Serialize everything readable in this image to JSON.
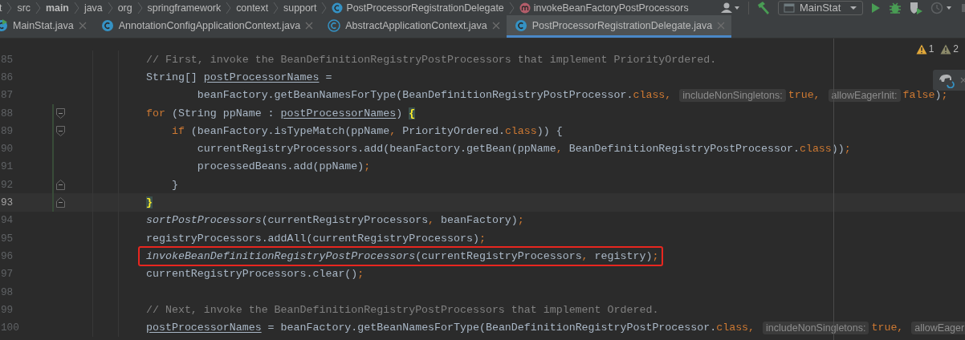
{
  "breadcrumbs": [
    {
      "label": "t",
      "kind": "folder",
      "bold": false
    },
    {
      "label": "src",
      "kind": "folder",
      "bold": false
    },
    {
      "label": "main",
      "kind": "folder",
      "bold": true
    },
    {
      "label": "java",
      "kind": "folder",
      "bold": false
    },
    {
      "label": "org",
      "kind": "folder",
      "bold": false
    },
    {
      "label": "springframework",
      "kind": "folder",
      "bold": false
    },
    {
      "label": "context",
      "kind": "folder",
      "bold": false
    },
    {
      "label": "support",
      "kind": "folder",
      "bold": false
    },
    {
      "label": "PostProcessorRegistrationDelegate",
      "kind": "class",
      "bold": false
    },
    {
      "label": "invokeBeanFactoryPostProcessors",
      "kind": "method",
      "bold": false
    }
  ],
  "toolbar": {
    "run_config": "MainStat"
  },
  "tabs": [
    {
      "label": "MainStat.java",
      "kind": "runnable",
      "selected": false
    },
    {
      "label": "AnnotationConfigApplicationContext.java",
      "kind": "class",
      "selected": false
    },
    {
      "label": "AbstractApplicationContext.java",
      "kind": "abstract",
      "selected": false
    },
    {
      "label": "PostProcessorRegistrationDelegate.java",
      "kind": "class",
      "selected": true
    }
  ],
  "inspections": [
    {
      "count": "1",
      "kind": "warning"
    },
    {
      "count": "2",
      "kind": "weak"
    }
  ],
  "code": [
    {
      "number": "85",
      "modified": false,
      "current": false,
      "highlighted": false,
      "tokens": [
        {
          "text": "// First, invoke the BeanDefinitionRegistryPostProcessors that implement PriorityOrdered.",
          "kind": "comment"
        }
      ]
    },
    {
      "number": "86",
      "modified": false,
      "current": false,
      "highlighted": false,
      "tokens": [
        {
          "text": "String[] ",
          "kind": "text"
        },
        {
          "text": "postProcessorNames",
          "kind": "var"
        },
        {
          "text": " =",
          "kind": "text"
        }
      ]
    },
    {
      "number": "87",
      "modified": false,
      "current": false,
      "highlighted": false,
      "tokens": [
        {
          "text": "        beanFactory.getBeanNamesForType(BeanDefinitionRegistryPostProcessor.",
          "kind": "text"
        },
        {
          "text": "class, ",
          "kind": "kw"
        },
        {
          "text": "includeNonSingletons:",
          "kind": "hint"
        },
        {
          "text": "true, ",
          "kind": "kw"
        },
        {
          "text": "allowEagerInit:",
          "kind": "hint"
        },
        {
          "text": "false",
          "kind": "kw"
        },
        {
          "text": ")",
          "kind": "text"
        },
        {
          "text": ";",
          "kind": "kw"
        }
      ]
    },
    {
      "number": "88",
      "modified": true,
      "kind": "opener",
      "current": false,
      "highlighted": false,
      "tokens": [
        {
          "text": "for",
          "kind": "kw"
        },
        {
          "text": " (String ppName : ",
          "kind": "text"
        },
        {
          "text": "postProcessorNames",
          "kind": "var"
        },
        {
          "text": ") ",
          "kind": "text"
        },
        {
          "text": "{",
          "kind": "brace"
        }
      ]
    },
    {
      "number": "89",
      "modified": true,
      "kind": "opener",
      "current": false,
      "highlighted": false,
      "tokens": [
        {
          "text": "    if",
          "kind": "kw"
        },
        {
          "text": " (beanFactory.isTypeMatch(ppName",
          "kind": "text"
        },
        {
          "text": ", ",
          "kind": "kw"
        },
        {
          "text": "PriorityOrdered.",
          "kind": "text"
        },
        {
          "text": "class",
          "kind": "kw"
        },
        {
          "text": ")) {",
          "kind": "text"
        }
      ]
    },
    {
      "number": "90",
      "modified": true,
      "current": false,
      "highlighted": false,
      "tokens": [
        {
          "text": "        currentRegistryProcessors.add(beanFactory.getBean(ppName",
          "kind": "text"
        },
        {
          "text": ", ",
          "kind": "kw"
        },
        {
          "text": "BeanDefinitionRegistryPostProcessor.",
          "kind": "text"
        },
        {
          "text": "class",
          "kind": "kw"
        },
        {
          "text": "))",
          "kind": "text"
        },
        {
          "text": ";",
          "kind": "kw"
        }
      ]
    },
    {
      "number": "91",
      "modified": true,
      "current": false,
      "highlighted": false,
      "tokens": [
        {
          "text": "        processedBeans.add(ppName)",
          "kind": "text"
        },
        {
          "text": ";",
          "kind": "kw"
        }
      ]
    },
    {
      "number": "92",
      "modified": true,
      "kind": "closer",
      "current": false,
      "highlighted": false,
      "tokens": [
        {
          "text": "    }",
          "kind": "text"
        }
      ]
    },
    {
      "number": "93",
      "modified": true,
      "kind": "closer",
      "current": true,
      "highlighted": false,
      "tokens": [
        {
          "text": "}",
          "kind": "brace"
        }
      ]
    },
    {
      "number": "94",
      "modified": false,
      "current": false,
      "highlighted": false,
      "tokens": [
        {
          "text": "sortPostProcessors",
          "kind": "static"
        },
        {
          "text": "(currentRegistryProcessors",
          "kind": "text"
        },
        {
          "text": ", ",
          "kind": "kw"
        },
        {
          "text": "beanFactory)",
          "kind": "text"
        },
        {
          "text": ";",
          "kind": "kw"
        }
      ]
    },
    {
      "number": "95",
      "modified": false,
      "current": false,
      "highlighted": false,
      "tokens": [
        {
          "text": "registryProcessors.addAll(currentRegistryProcessors)",
          "kind": "text"
        },
        {
          "text": ";",
          "kind": "kw"
        }
      ]
    },
    {
      "number": "96",
      "modified": false,
      "current": false,
      "highlighted": true,
      "tokens": [
        {
          "text": "invokeBeanDefinitionRegistryPostProcessors",
          "kind": "static"
        },
        {
          "text": "(currentRegistryProcessors",
          "kind": "text"
        },
        {
          "text": ", ",
          "kind": "kw"
        },
        {
          "text": "registry)",
          "kind": "text"
        },
        {
          "text": ";",
          "kind": "kw"
        }
      ]
    },
    {
      "number": "97",
      "modified": false,
      "current": false,
      "highlighted": false,
      "tokens": [
        {
          "text": "currentRegistryProcessors.clear()",
          "kind": "text"
        },
        {
          "text": ";",
          "kind": "kw"
        }
      ]
    },
    {
      "number": "98",
      "modified": false,
      "current": false,
      "highlighted": false
    },
    {
      "number": "99",
      "modified": false,
      "current": false,
      "highlighted": false,
      "tokens": [
        {
          "text": "// Next, invoke the BeanDefinitionRegistryPostProcessors that implement Ordered.",
          "kind": "comment"
        }
      ]
    },
    {
      "number": "100",
      "modified": false,
      "current": false,
      "highlighted": false,
      "tokens": [
        {
          "text": "postProcessorNames",
          "kind": "var"
        },
        {
          "text": " = beanFactory.getBeanNamesForType(BeanDefinitionRegistryPostProcessor.",
          "kind": "text"
        },
        {
          "text": "class, ",
          "kind": "kw"
        },
        {
          "text": "includeNonSingletons:",
          "kind": "hint"
        },
        {
          "text": "true, ",
          "kind": "kw"
        },
        {
          "text": "allowEager",
          "kind": "hint"
        }
      ]
    }
  ]
}
